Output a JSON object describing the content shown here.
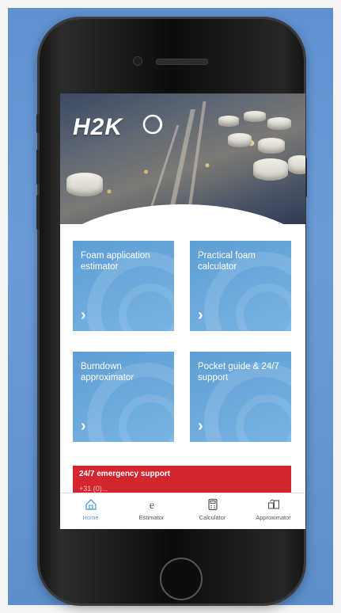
{
  "brand": {
    "logo_text": "H2K"
  },
  "tiles": [
    {
      "label": "Foam application estimator"
    },
    {
      "label": "Practical foam calculator"
    },
    {
      "label": "Burndown approximator"
    },
    {
      "label": "Pocket guide & 24/7 support"
    }
  ],
  "chevron": "›",
  "emergency": {
    "title": "24/7 emergency support",
    "subtitle": "+31 (0)..."
  },
  "tabs": [
    {
      "label": "Home",
      "icon": "home-icon",
      "active": true
    },
    {
      "label": "Estimator",
      "icon": "estimator-icon",
      "active": false
    },
    {
      "label": "Calculator",
      "icon": "calculator-icon",
      "active": false
    },
    {
      "label": "Approximator",
      "icon": "approximator-icon",
      "active": false
    }
  ],
  "colors": {
    "accent": "#5c9fd6",
    "tile": "#6aa9dc",
    "emergency": "#d4262e"
  }
}
